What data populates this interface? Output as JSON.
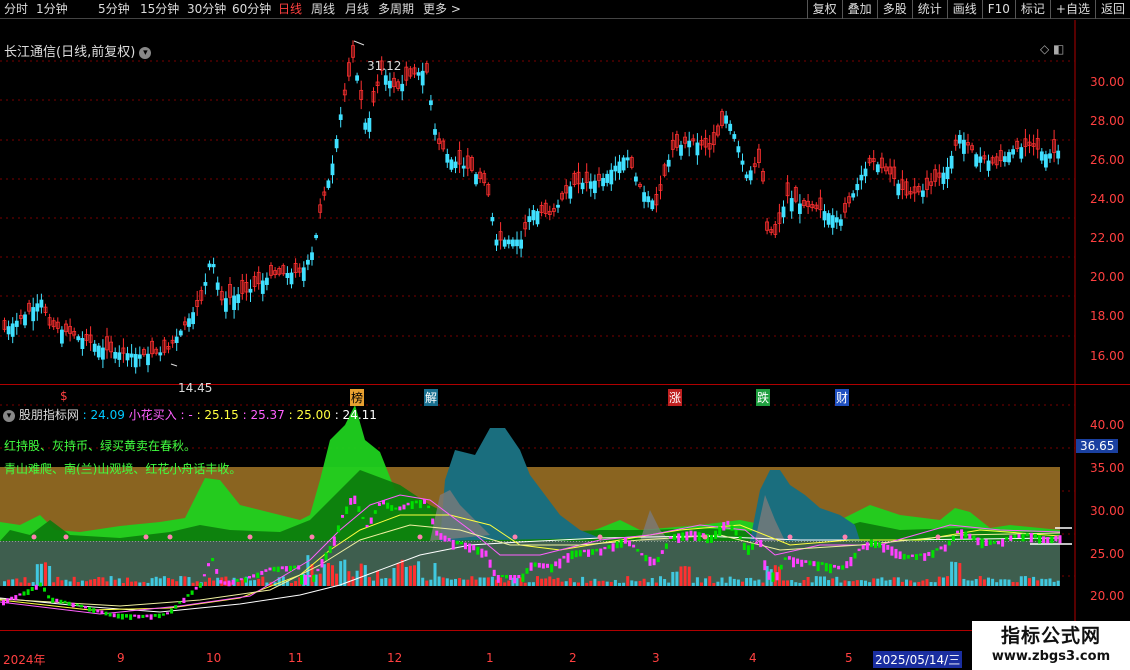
{
  "topbar": {
    "periods": [
      "分时",
      "1分钟",
      "5分钟",
      "15分钟",
      "30分钟",
      "60分钟",
      "日线",
      "周线",
      "月线",
      "多周期",
      "更多 >"
    ],
    "active_period": "日线",
    "tools": [
      "复权",
      "叠加",
      "多股",
      "统计",
      "画线",
      "F10",
      "标记",
      "+自选",
      "返回"
    ]
  },
  "main": {
    "title": "长江通信(日线,前复权)",
    "high_label": "31.12",
    "low_label": "14.45",
    "y_ticks": [
      "30.00",
      "28.00",
      "26.00",
      "24.00",
      "22.00",
      "20.00",
      "18.00",
      "16.00"
    ],
    "markers": [
      "$",
      "榜",
      "解",
      "涨",
      "跌",
      "财"
    ]
  },
  "indicator": {
    "name": "股朋指标网",
    "values": [
      {
        "text": ": 24.09",
        "color": "#00c8ff"
      },
      {
        "text": "小花买入 : -",
        "color": "#ff60ff"
      },
      {
        "text": ": 25.15",
        "color": "#ffff40"
      },
      {
        "text": ": 25.37",
        "color": "#ff60ff"
      },
      {
        "text": ": 25.00",
        "color": "#ffff40"
      },
      {
        "text": ": 24.11",
        "color": "#ffffff"
      }
    ],
    "line1": "红持股、灰持币、绿买黄卖在春秋。",
    "line2": "青山难爬、南(兰)山观境、红花小舟话丰收。",
    "y_ticks": [
      "40.00",
      "35.00",
      "30.00",
      "25.00",
      "20.00"
    ],
    "current_value": "36.65"
  },
  "x_axis": {
    "labels": [
      "2024年",
      "9",
      "10",
      "11",
      "12",
      "1",
      "2",
      "3",
      "4",
      "5"
    ],
    "date_readout": "2025/05/14/三"
  },
  "watermark": {
    "line1": "指标公式网",
    "line2": "www.zbgs3.com"
  },
  "colors": {
    "up": "#ff3030",
    "down": "#40e0ff",
    "axis": "#b00000",
    "green": "#00c000",
    "teal": "#1a6e7e",
    "band": "#8a6420"
  }
}
